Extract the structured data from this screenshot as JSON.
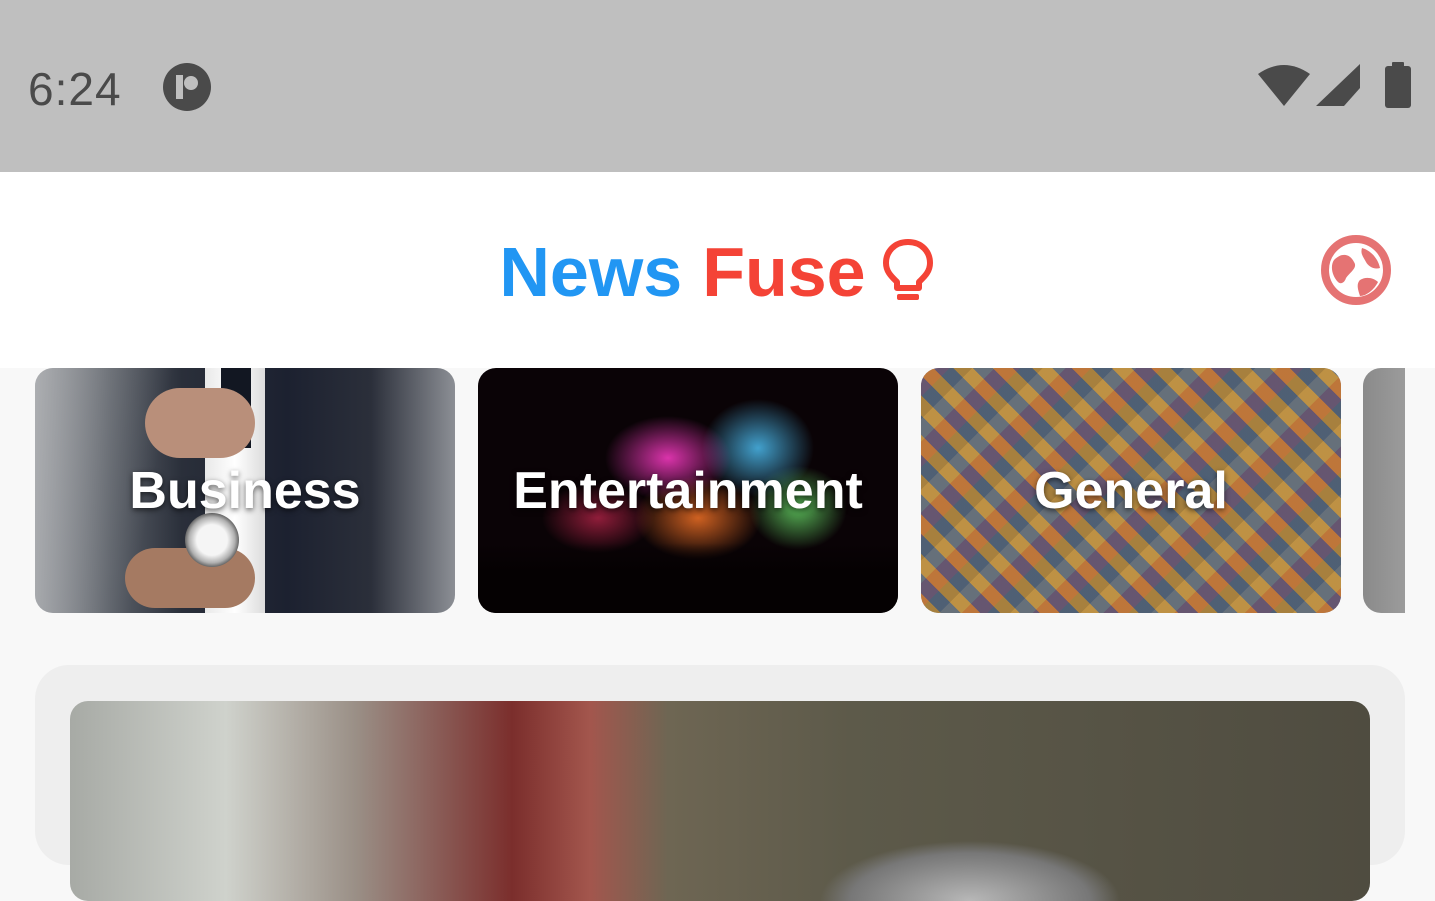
{
  "status_bar": {
    "time": "6:24",
    "icons": [
      "app-notification-icon",
      "wifi-icon",
      "cellular-signal-icon",
      "battery-icon"
    ]
  },
  "app_bar": {
    "title_part1": "News",
    "title_part2": "Fuse",
    "title_icon": "lightbulb-icon",
    "action_icon": "globe-icon",
    "colors": {
      "news": "#2196f3",
      "fuse": "#f44336",
      "globe": "#e57373"
    }
  },
  "categories": [
    {
      "label": "Business"
    },
    {
      "label": "Entertainment"
    },
    {
      "label": "General"
    },
    {
      "label": ""
    }
  ]
}
